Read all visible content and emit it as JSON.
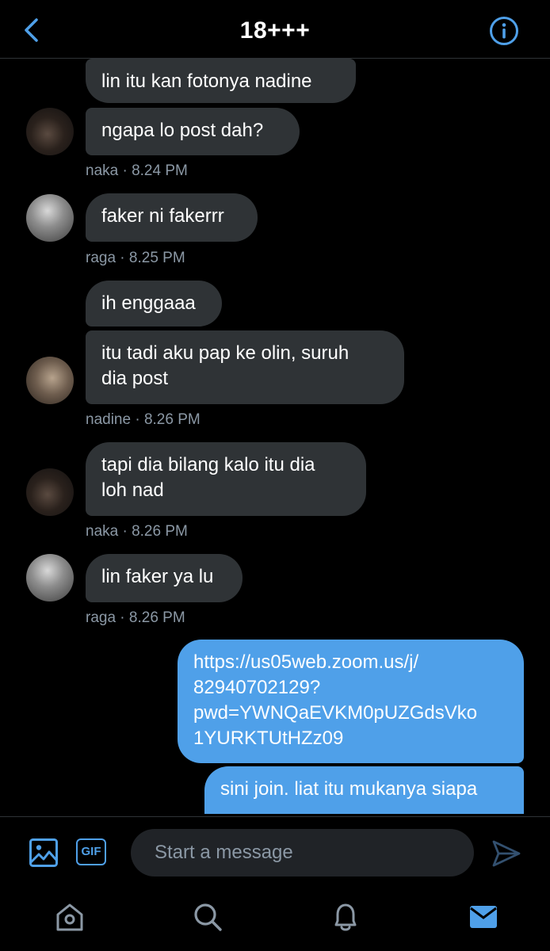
{
  "header": {
    "title": "18+++"
  },
  "messages": [
    {
      "id": "m1",
      "text": "lin itu kan fotonya nadine"
    },
    {
      "id": "m2",
      "text": "ngapa lo post dah?"
    },
    {
      "id": "meta1",
      "text": "naka · 8.24 PM"
    },
    {
      "id": "m3",
      "text": "faker ni fakerrr"
    },
    {
      "id": "meta2",
      "text": "raga · 8.25 PM"
    },
    {
      "id": "m4",
      "text": "ih enggaaa"
    },
    {
      "id": "m5",
      "text": "itu tadi aku pap ke olin, suruh\ndia post"
    },
    {
      "id": "meta3",
      "text": "nadine · 8.26 PM"
    },
    {
      "id": "m6",
      "text": "tapi dia bilang kalo itu dia\nloh nad"
    },
    {
      "id": "meta4",
      "text": "naka · 8.26 PM"
    },
    {
      "id": "m7",
      "text": "lin faker ya lu"
    },
    {
      "id": "meta5",
      "text": "raga · 8.26 PM"
    },
    {
      "id": "m8",
      "text": "https://us05web.zoom.us/j/\n82940702129?\npwd=YWNQaEVKM0pUZGdsVko\n1YURKTUtHZz09"
    },
    {
      "id": "m9",
      "text": "sini join. liat itu mukanya siapa"
    }
  ],
  "composer": {
    "placeholder": "Start a message",
    "gif_label": "GIF"
  },
  "colors": {
    "accent": "#4fa0e9",
    "incoming_bubble": "#2f3336",
    "meta_text": "#8b98a5"
  },
  "icons": [
    "back-arrow-icon",
    "info-icon",
    "image-icon",
    "gif-icon",
    "send-icon",
    "home-icon",
    "search-icon",
    "bell-icon",
    "mail-icon"
  ]
}
